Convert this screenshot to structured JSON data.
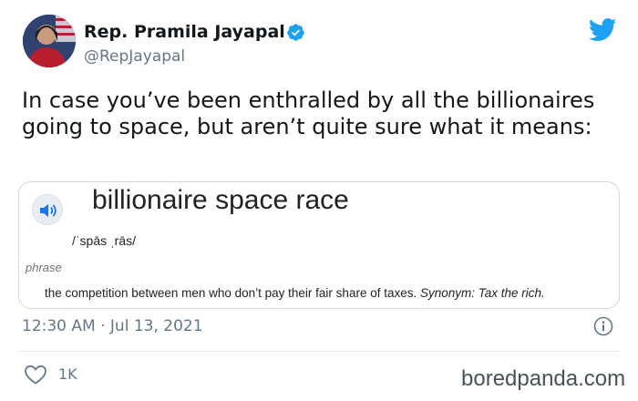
{
  "author": {
    "display_name": "Rep. Pramila Jayapal",
    "handle": "@RepJayapal",
    "verified": true
  },
  "tweet": {
    "text": "In case you’ve been enthralled by all the billionaires going to space, but aren’t quite sure what it means:",
    "timestamp": "12:30 AM · Jul 13, 2021",
    "likes": "1K"
  },
  "card": {
    "headword": "billionaire space race",
    "pronunciation": "/ˈspās ˌrās/",
    "part_of_speech": "phrase",
    "definition": "the competition between men who don’t pay their fair share of taxes.",
    "synonym": "Synonym: Tax the rich."
  },
  "watermark": "boredpanda.com",
  "icons": {
    "verified": "verified-badge-icon",
    "twitter": "twitter-bird-icon",
    "speaker": "speaker-icon",
    "info": "info-icon",
    "like": "heart-icon"
  },
  "colors": {
    "twitter_blue": "#1da1f2",
    "text_primary": "#14171a",
    "text_secondary": "#657786"
  }
}
